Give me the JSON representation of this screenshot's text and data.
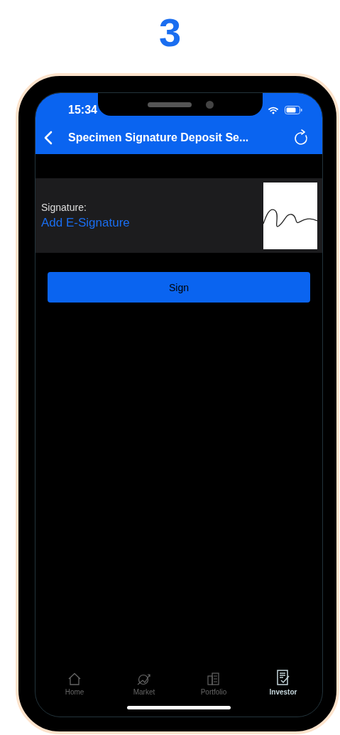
{
  "step": "3",
  "status_bar": {
    "time": "15:34"
  },
  "nav": {
    "title": "Specimen Signature Deposit Se..."
  },
  "signature": {
    "label": "Signature:",
    "link": "Add E-Signature"
  },
  "sign_button": "Sign",
  "tabs": [
    {
      "label": "Home",
      "kind": "home",
      "selected": false
    },
    {
      "label": "Market",
      "kind": "market",
      "selected": false
    },
    {
      "label": "Portfolio",
      "kind": "portfolio",
      "selected": false
    },
    {
      "label": "Investor",
      "kind": "investor",
      "selected": true
    }
  ]
}
